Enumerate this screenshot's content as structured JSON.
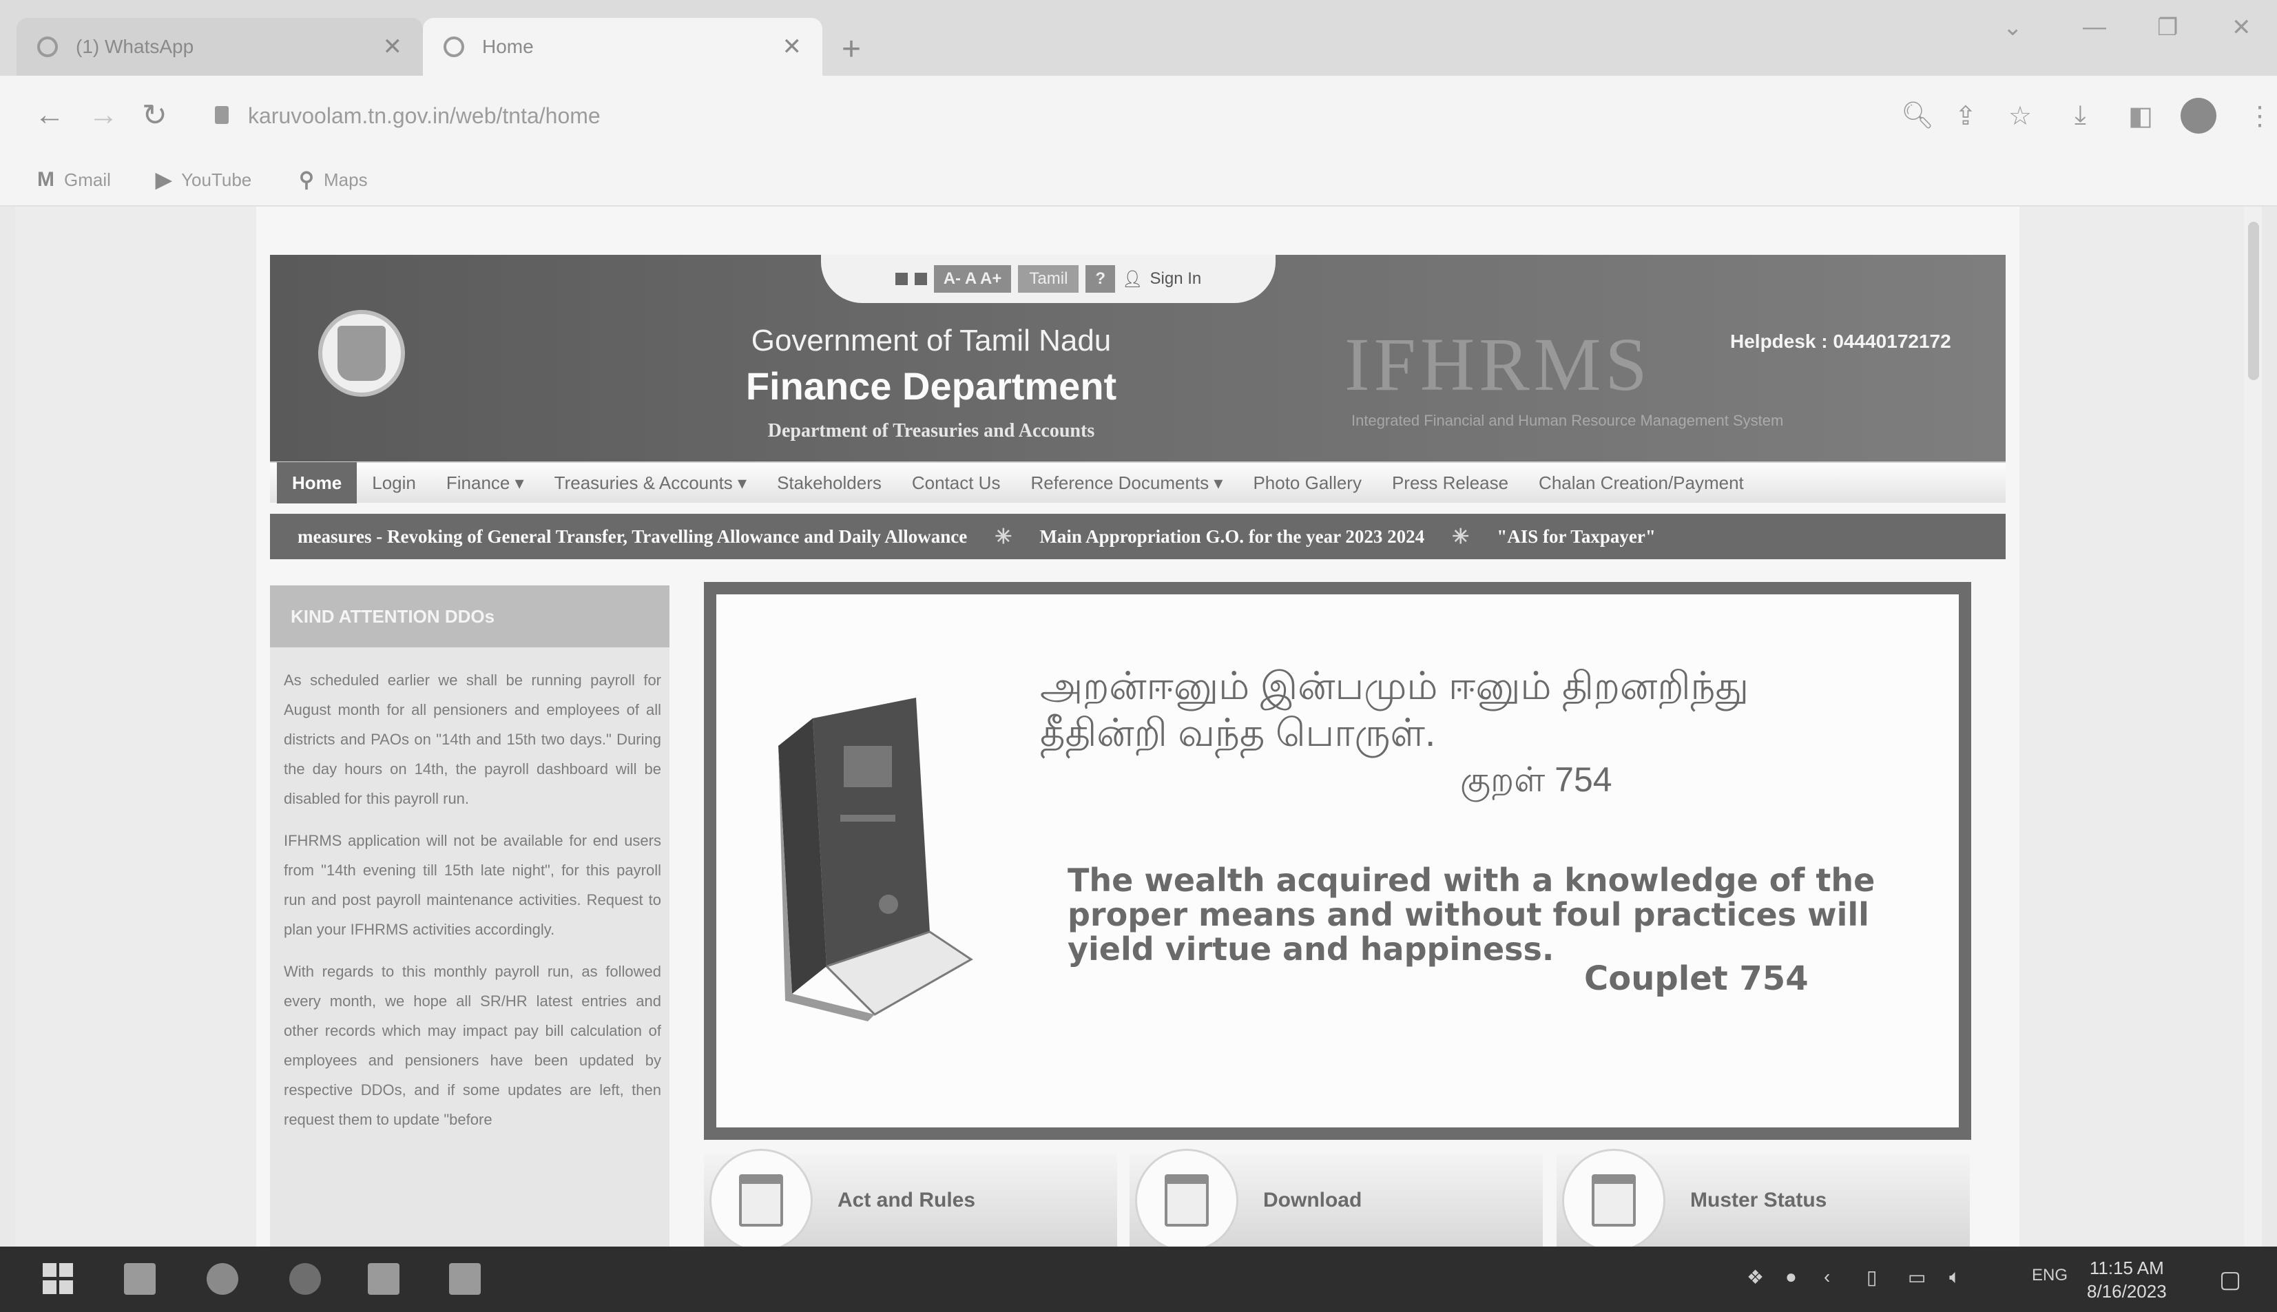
{
  "browser": {
    "tabs": [
      {
        "label": "(1) WhatsApp",
        "active": false
      },
      {
        "label": "Home",
        "active": true
      }
    ],
    "new_tab": "+",
    "url": "karuvoolam.tn.gov.in/web/tnta/home",
    "bookmarks": [
      {
        "label": "Gmail",
        "icon": "gmail-icon"
      },
      {
        "label": "YouTube",
        "icon": "youtube-icon"
      },
      {
        "label": "Maps",
        "icon": "maps-icon"
      }
    ]
  },
  "site": {
    "topstrip": {
      "font_sizes": "A- A A+",
      "language": "Tamil",
      "help": "?",
      "signin": "Sign In"
    },
    "gov_title": "Government of Tamil Nadu",
    "dept_title": "Finance Department",
    "subdept_title": "Department of Treasuries and Accounts",
    "watermark": "IFHRMS",
    "watermark_sub": "Integrated Financial and Human Resource Management System",
    "helpdesk": "Helpdesk : 04440172172",
    "menu": [
      "Home",
      "Login",
      "Finance ▾",
      "Treasuries & Accounts ▾",
      "Stakeholders",
      "Contact Us",
      "Reference Documents ▾",
      "Photo Gallery",
      "Press Release",
      "Chalan Creation/Payment"
    ],
    "ticker": [
      "measures - Revoking of General Transfer, Travelling Allowance and Daily Allowance",
      "Main Appropriation G.O. for the year 2023 2024",
      "\"AIS for Taxpayer\""
    ],
    "notice": {
      "heading": "KIND ATTENTION DDOs",
      "paragraphs": [
        "As scheduled earlier we shall be running payroll for August month for all pensioners and employees of all districts and PAOs on \"14th and 15th two days.\" During the day hours on 14th, the payroll dashboard will be disabled for this payroll run.",
        "IFHRMS application will not be available for end users from \"14th evening till 15th late night\", for this payroll run and post payroll maintenance activities. Request to plan your IFHRMS activities accordingly.",
        "With regards to this monthly payroll run, as followed every month, we hope all SR/HR latest entries and other records which may impact pay bill calculation of employees and pensioners have been updated by respective DDOs, and if some updates are left, then request them to update \"before"
      ]
    },
    "slide": {
      "tamil_line1": "அறன்ஈனும் இன்பமும் ஈனும் திறனறிந்து",
      "tamil_line2": "தீதின்றி வந்த பொருள்.",
      "kural_no": "குறள் 754",
      "english": "The wealth acquired with a knowledge of the proper means and without foul practices will yield virtue and happiness.",
      "couplet": "Couplet 754"
    },
    "quick_links": [
      "Act and Rules",
      "Download",
      "Muster Status"
    ]
  },
  "taskbar": {
    "lang": "ENG",
    "time": "11:15 AM",
    "date": "8/16/2023"
  }
}
